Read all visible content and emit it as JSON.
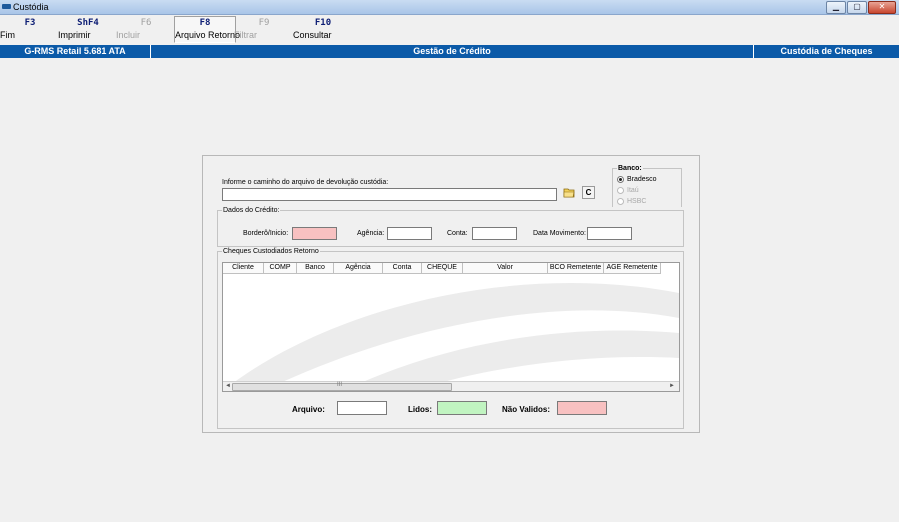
{
  "window": {
    "title": "Custódia",
    "min_label": "▁",
    "max_label": "▢",
    "close_label": "✕"
  },
  "toolbar": {
    "buttons": [
      {
        "key": "F3",
        "label": "Fim",
        "enabled": true
      },
      {
        "key": "ShF4",
        "label": "Imprimir",
        "enabled": true
      },
      {
        "key": "F6",
        "label": "Incluir",
        "enabled": false
      },
      {
        "key": "F8",
        "label": "Arquivo Retorno",
        "enabled": true,
        "active": true
      },
      {
        "key": "F9",
        "label": "Filtrar",
        "enabled": false
      },
      {
        "key": "F10",
        "label": "Consultar",
        "enabled": true
      }
    ]
  },
  "header": {
    "system": "G-RMS Retail 5.681 ATA",
    "module": "Gestão de Crédito",
    "screen": "Custódia de Cheques",
    "color": "#0b5aa8"
  },
  "form": {
    "path_label": "Informe o caminho do arquivo de devolução custódia:",
    "path_value": "",
    "folder_icon": "folder-open-icon",
    "clear_label": "C",
    "banco": {
      "title": "Banco:",
      "options": [
        {
          "label": "Bradesco",
          "checked": true,
          "enabled": true
        },
        {
          "label": "Itaú",
          "checked": false,
          "enabled": false
        },
        {
          "label": "HSBC",
          "checked": false,
          "enabled": false
        }
      ]
    },
    "dados": {
      "title": "Dados do Crédito:",
      "bordero_label": "Borderô/Inicio:",
      "agencia_label": "Agência:",
      "conta_label": "Conta:",
      "data_label": "Data Movimento:"
    },
    "cheques": {
      "title": "Cheques Custodiados Retorno",
      "columns": [
        "Cliente",
        "COMP",
        "Banco",
        "Agência",
        "Conta",
        "CHEQUE",
        "Valor",
        "BCO Remetente",
        "AGE Remetente"
      ],
      "scroll_grip": "III"
    },
    "footer": {
      "arquivo_label": "Arquivo:",
      "lidos_label": "Lidos:",
      "nao_validos_label": "Não Validos:"
    },
    "colors": {
      "pink": "#f8c1c1",
      "green": "#c1f4c1"
    }
  }
}
